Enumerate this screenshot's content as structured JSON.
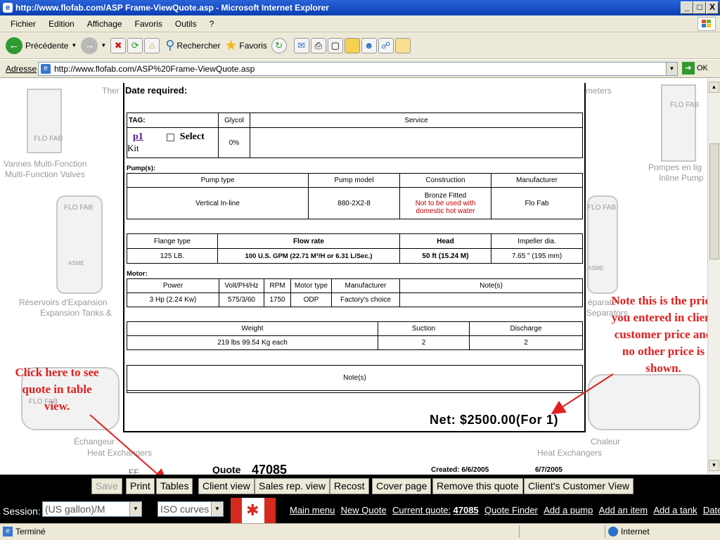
{
  "window": {
    "title": "http://www.flofab.com/ASP Frame-ViewQuote.asp - Microsoft Internet Explorer",
    "min": "_",
    "max": "□",
    "close": "X"
  },
  "menu": [
    "Fichier",
    "Edition",
    "Affichage",
    "Favoris",
    "Outils",
    "?"
  ],
  "toolbar": {
    "back": "Précédente",
    "search": "Rechercher",
    "favorites": "Favoris"
  },
  "address": {
    "label": "Adresse",
    "url": "http://www.flofab.com/ASP%20Frame-ViewQuote.asp",
    "go": "OK"
  },
  "background": {
    "ther": "Ther",
    "meters": "meters",
    "valves_fr": "Vannes Multi-Fonction",
    "valves_en": "Multi-Function Valves",
    "pumps_fr": "Pompes en lig",
    "pumps_en": "Inline Pump",
    "tanks_fr": "Réservoirs d'Expansion",
    "tanks_en": "Expansion Tanks &",
    "sep_fr": "éparate",
    "sep_en": "Separators",
    "hx_fr": "Échangeur",
    "hx_en": "Heat Exchangers",
    "hx2_fr": "Chaleur",
    "hx2_en": "Heat Exchangers",
    "logo": "FLO FAB",
    "asme": "ASME"
  },
  "quote": {
    "date_required": "Date required:",
    "tag_header": "TAG:",
    "glycol_header": "Glycol",
    "service_header": "Service",
    "tag_value": "p1",
    "select_label": "Select",
    "kit_label": "Kit",
    "glycol_value": "0%",
    "pumps_label": "Pump(s):",
    "pump_headers": [
      "Pump type",
      "Pump model",
      "Construction",
      "Manufacturer"
    ],
    "pump_type": "Vertical In-line",
    "pump_model": "880-2X2-8",
    "construction": "Bronze Fitted",
    "construction_note_1": "Not to be used with",
    "construction_note_2": "domestic hot water",
    "manufacturer": "Flo Fab",
    "flow_headers": [
      "Flange type",
      "Flow rate",
      "Head",
      "Impeller dia."
    ],
    "flange": "125 LB.",
    "flow": "100 U.S. GPM (22.71 M³/H or 6.31 L/Sec.)",
    "head": "50 ft (15.24 M)",
    "impeller": "7.65 \" (195 mm)",
    "motor_label": "Motor:",
    "motor_headers": [
      "Power",
      "Volt/PH/Hz",
      "RPM",
      "Motor type",
      "Manufacturer",
      "Note(s)"
    ],
    "motor_values": [
      "3 Hp (2.24 Kw)",
      "575/3/60",
      "1750",
      "ODP",
      "Factory's choice",
      ""
    ],
    "weight_headers": [
      "Weight",
      "Suction",
      "Discharge"
    ],
    "weight_values": [
      "219 lbs 99.54 Kg each",
      "2",
      "2"
    ],
    "notes_header": "Note(s)",
    "net": "Net: $2500.00(For 1)",
    "quote_label": "Quote",
    "quote_number": "47085",
    "created": "Created: 6/6/2005",
    "date2": "6/7/2005"
  },
  "annotations": {
    "click_here": "Click here to see quote in table view.",
    "note_price": "Note this is the price you entered in client customer price and no other price is shown."
  },
  "buttons": [
    "Save",
    "Print",
    "Tables",
    "Client view",
    "Sales rep. view",
    "Recost",
    "Cover page",
    "Remove this quote",
    "Client's Customer View"
  ],
  "session": {
    "label": "Session:",
    "unit_value": "(US gallon)/M",
    "curves_value": "ISO curves"
  },
  "links": {
    "main_menu": "Main menu",
    "new_quote": "New Quote",
    "current_quote": "Current quote:",
    "current_quote_number": "47085",
    "quote_finder": "Quote Finder",
    "add_pump": "Add a pump",
    "add_item": "Add an item",
    "add_tank": "Add a tank",
    "dates": "Dates"
  },
  "status": {
    "left": "Terminé",
    "zone": "Internet"
  },
  "colors": {
    "annotation": "#e02020",
    "title_bar": "#0b3fb3",
    "canada_red": "#d52b1e"
  }
}
